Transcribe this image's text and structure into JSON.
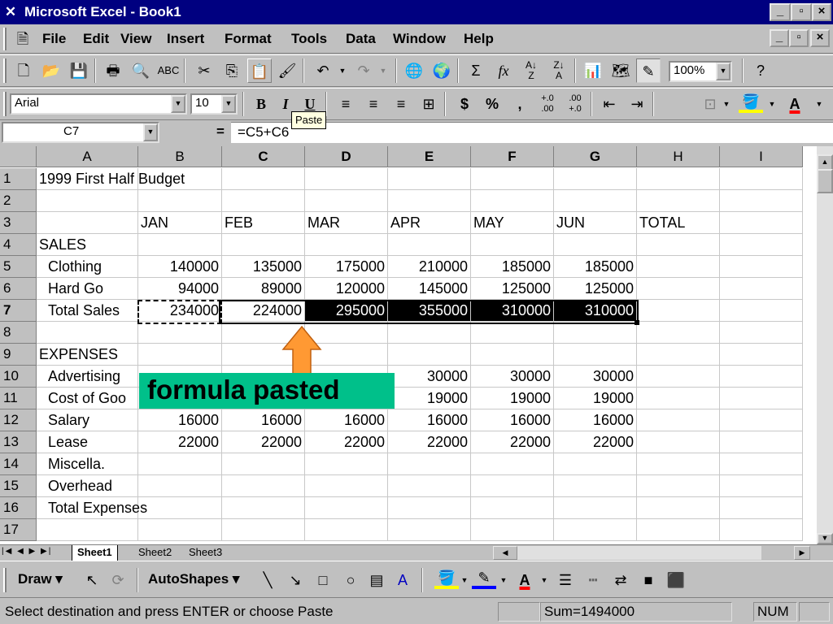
{
  "window": {
    "title": "Microsoft Excel - Book1"
  },
  "menu": [
    "File",
    "Edit",
    "View",
    "Insert",
    "Format",
    "Tools",
    "Data",
    "Window",
    "Help"
  ],
  "standard_toolbar": {
    "zoom": "100%"
  },
  "formatting_toolbar": {
    "font": "Arial",
    "size": "10"
  },
  "tooltip": "Paste",
  "formula_bar": {
    "name_box": "C7",
    "equals": "=",
    "formula": "=C5+C6"
  },
  "columns": [
    "A",
    "B",
    "C",
    "D",
    "E",
    "F",
    "G",
    "H",
    "I"
  ],
  "rows": [
    "1",
    "2",
    "3",
    "4",
    "5",
    "6",
    "7",
    "8",
    "9",
    "10",
    "11",
    "12",
    "13",
    "14",
    "15",
    "16",
    "17"
  ],
  "cells": {
    "A1": "1999 First Half Budget",
    "B3": "JAN",
    "C3": "FEB",
    "D3": "MAR",
    "E3": "APR",
    "F3": "MAY",
    "G3": "JUN",
    "H3": "TOTAL",
    "A4": "SALES",
    "A5": "Clothing",
    "B5": "140000",
    "C5": "135000",
    "D5": "175000",
    "E5": "210000",
    "F5": "185000",
    "G5": "185000",
    "A6": "Hard Go",
    "B6": "94000",
    "C6": "89000",
    "D6": "120000",
    "E6": "145000",
    "F6": "125000",
    "G6": "125000",
    "A7": "Total Sales",
    "B7": "234000",
    "C7": "224000",
    "D7": "295000",
    "E7": "355000",
    "F7": "310000",
    "G7": "310000",
    "A9": "EXPENSES",
    "A10": "Advertising",
    "E10": "30000",
    "F10": "30000",
    "G10": "30000",
    "A11": "Cost of Goo",
    "E11": "19000",
    "F11": "19000",
    "G11": "19000",
    "A12": "Salary",
    "B12": "16000",
    "C12": "16000",
    "D12": "16000",
    "E12": "16000",
    "F12": "16000",
    "G12": "16000",
    "A13": "Lease",
    "B13": "22000",
    "C13": "22000",
    "D13": "22000",
    "E13": "22000",
    "F13": "22000",
    "G13": "22000",
    "A14": "Miscella.",
    "A15": "Overhead",
    "A16": "Total Expenses"
  },
  "sheet_tabs": [
    "Sheet1",
    "Sheet2",
    "Sheet3"
  ],
  "active_sheet": "Sheet1",
  "drawing_toolbar": {
    "draw": "Draw",
    "autoshapes": "AutoShapes"
  },
  "status": {
    "message": "Select destination and press ENTER or choose Paste",
    "sum": "Sum=1494000",
    "num": "NUM"
  },
  "annotation": "formula pasted",
  "colors": {
    "title_bar": "#000080",
    "callout": "#00c08a",
    "arrow": "#ff9933",
    "selection": "#000000"
  }
}
